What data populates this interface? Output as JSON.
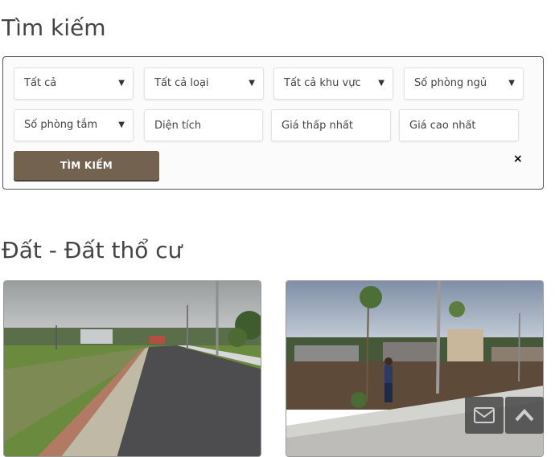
{
  "search": {
    "title": "Tìm kiếm",
    "row1": [
      {
        "label": "Tất cả"
      },
      {
        "label": "Tất cả loại"
      },
      {
        "label": "Tất cả khu vực"
      },
      {
        "label": "Số phòng ngủ"
      }
    ],
    "bathrooms_label": "Số phòng tắm",
    "area_placeholder": "Diện tích",
    "min_price_placeholder": "Giá thấp nhất",
    "max_price_placeholder": "Giá cao nhất",
    "search_button": "TÌM KIẾM",
    "close_symbol": "×"
  },
  "listing": {
    "title": "Đất - Đất thổ cư"
  },
  "icons": {
    "dropdown": "triangle-down-icon",
    "mail": "mail-icon",
    "scroll_top": "chevron-up-icon"
  },
  "colors": {
    "button": "#736250",
    "panel_border": "#555555"
  }
}
